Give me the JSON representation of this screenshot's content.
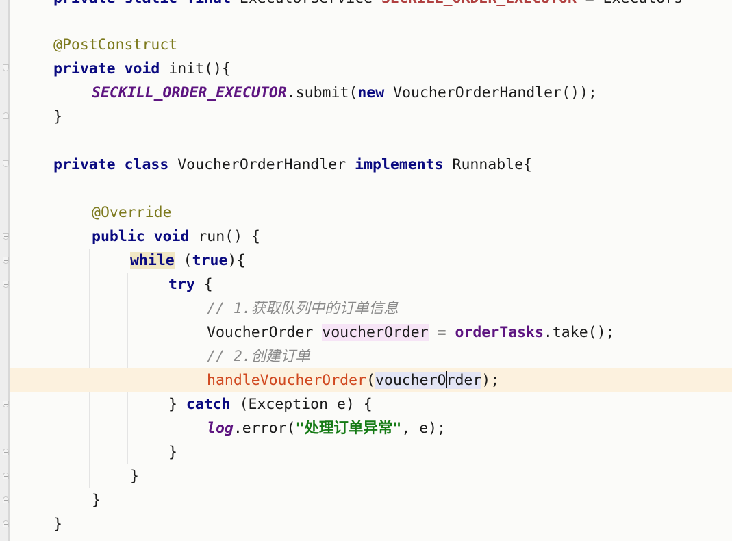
{
  "editor": {
    "partial_top_line": {
      "kw1": "private",
      "kw2": "static",
      "kw3": "final",
      "type": "ExecutorService",
      "field": "SECKILL_ORDER_EXECUTOR",
      "rest": " = Executors"
    },
    "lines": {
      "l1": {
        "anno": "@PostConstruct"
      },
      "l2": {
        "kw1": "private",
        "kw2": "void",
        "text": " init(){"
      },
      "l3": {
        "field": "SECKILL_ORDER_EXECUTOR",
        "text1": ".submit(",
        "kw": "new",
        "text2": " VoucherOrderHandler());"
      },
      "l4": {
        "text": "}"
      },
      "l5": {
        "kw1": "private",
        "kw2": "class",
        "text1": " VoucherOrderHandler ",
        "kw3": "implements",
        "text2": " Runnable{"
      },
      "l6": {
        "anno": "@Override"
      },
      "l7": {
        "kw1": "public",
        "kw2": "void",
        "text": " run() {"
      },
      "l8": {
        "kw": "while",
        "text1": " (",
        "kw2": "true",
        "text2": "){"
      },
      "l9": {
        "kw": "try",
        "text": " {"
      },
      "l10": {
        "comment": "// 1.获取队列中的订单信息"
      },
      "l11": {
        "type": "VoucherOrder ",
        "var": "voucherOrder",
        "text1": " = ",
        "field": "orderTasks",
        "text2": ".take();"
      },
      "l12": {
        "comment": "// 2.创建订单"
      },
      "l13": {
        "method": "handleVoucherOrder",
        "open": "(",
        "param_before": "voucherO",
        "param_after": "rder",
        "close": ");"
      },
      "l14": {
        "brace": "} ",
        "kw": "catch",
        "text": " (Exception e) {"
      },
      "l15": {
        "field": "log",
        "text1": ".error(",
        "string": "\"处理订单异常\"",
        "text2": ", e);"
      },
      "l16": {
        "text": "}"
      },
      "l17": {
        "text": "}"
      },
      "l18": {
        "text": "}"
      },
      "l19": {
        "text": "}"
      }
    }
  }
}
